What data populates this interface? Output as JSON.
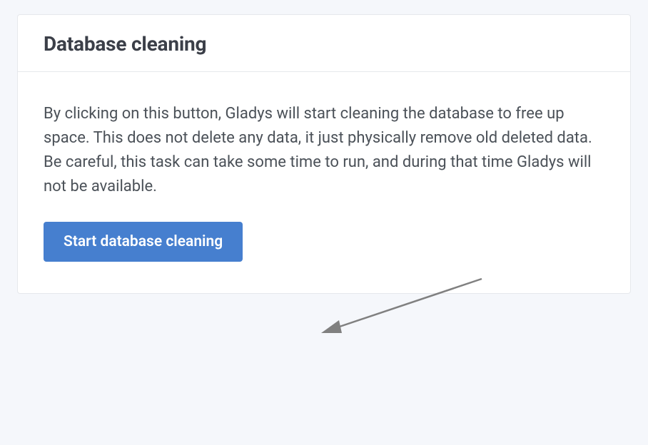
{
  "card": {
    "title": "Database cleaning",
    "description": "By clicking on this button, Gladys will start cleaning the database to free up space. This does not delete any data, it just physically remove old deleted data. Be careful, this task can take some time to run, and during that time Gladys will not be available.",
    "button_label": "Start database cleaning"
  }
}
